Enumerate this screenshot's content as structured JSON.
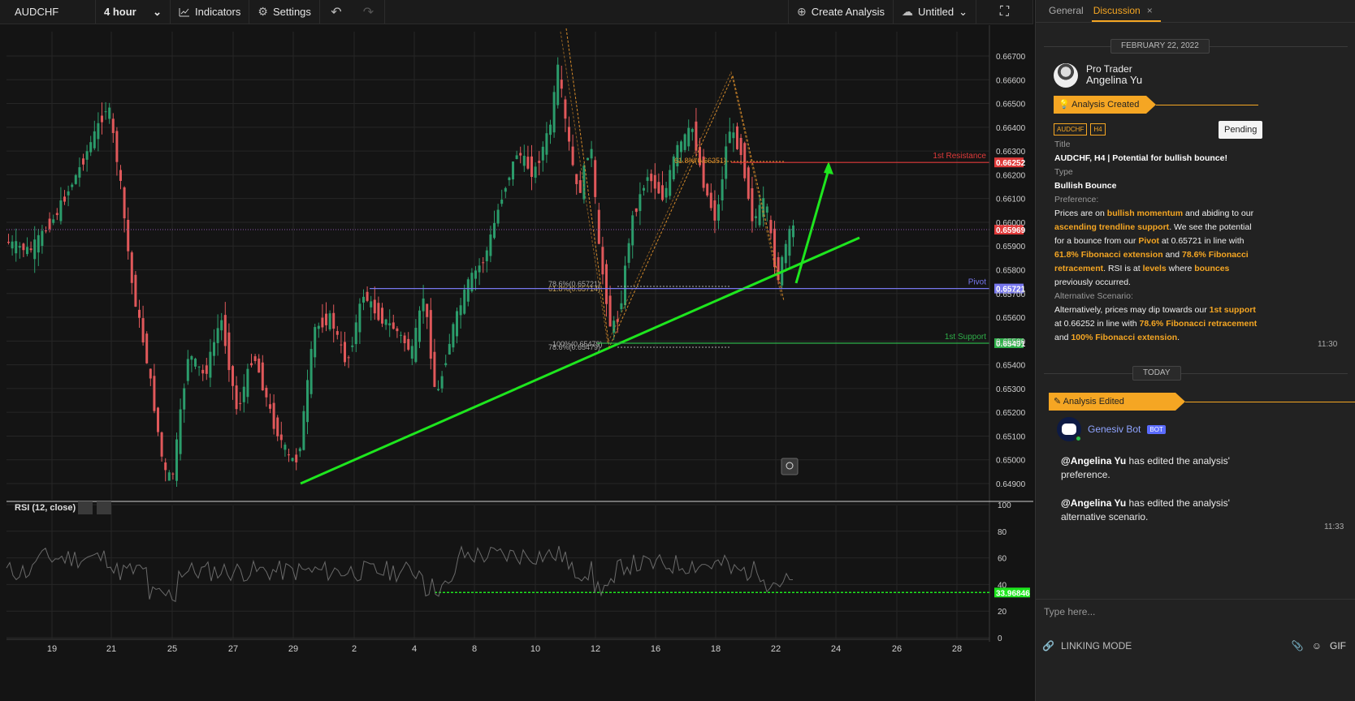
{
  "toolbar": {
    "symbol": "AUDCHF",
    "interval": "4 hour",
    "indicators_label": "Indicators",
    "settings_label": "Settings",
    "create_analysis_label": "Create Analysis",
    "layout_name": "Untitled"
  },
  "chart": {
    "price_ticks": [
      "0.66700",
      "0.66600",
      "0.66500",
      "0.66400",
      "0.66300",
      "0.66200",
      "0.66100",
      "0.66000",
      "0.65900",
      "0.65800",
      "0.65700",
      "0.65600",
      "0.65500",
      "0.65400",
      "0.65300",
      "0.65200",
      "0.65100",
      "0.65000",
      "0.64900"
    ],
    "date_ticks": [
      "19",
      "21",
      "25",
      "27",
      "29",
      "2",
      "4",
      "8",
      "10",
      "12",
      "16",
      "18",
      "20",
      "22",
      "24",
      "26",
      "28"
    ],
    "levels": [
      {
        "name": "1st Resistance",
        "price": 0.66252,
        "label": "0.66252",
        "color": "#e03a3a"
      },
      {
        "name": "Pivot",
        "price": 0.65721,
        "label": "0.65721",
        "color": "#7777ee"
      },
      {
        "name": "1st Support",
        "price": 0.65491,
        "label": "0.65491",
        "color": "#2fb04a"
      }
    ],
    "last_price": {
      "price": 0.65969,
      "label": "0.65969",
      "color": "#e03a3a"
    },
    "fib_labels": [
      "61.8%(0.66251)",
      "78.6%(0.65721)",
      "61.8%(0.65714)",
      "100%(0.65479)",
      "78.6%(0.65479)"
    ],
    "rsi": {
      "title": "RSI (12, close)",
      "ticks": [
        "100",
        "80",
        "60",
        "40",
        "20",
        "0"
      ],
      "value_label": "33.96846",
      "level": 33.96846
    }
  },
  "panel": {
    "tabs": [
      "General",
      "Discussion"
    ],
    "date1": "FEBRUARY 22, 2022",
    "author_role": "Pro Trader",
    "author_name": "Angelina Yu",
    "created_banner": "Analysis Created",
    "tags": [
      "AUDCHF",
      "H4"
    ],
    "status": "Pending",
    "title_label": "Title",
    "title_value": "AUDCHF, H4 | Potential for bullish bounce!",
    "type_label": "Type",
    "type_value": "Bullish Bounce",
    "pref_label": "Preference:",
    "pref": {
      "t1": "Prices are on ",
      "h1": "bullish momentum",
      "t2": " and abiding to our ",
      "h2": "ascending trendline support",
      "t3": ". We see the potential for a bounce from our ",
      "h3": "Pivot",
      "t4": " at 0.65721 in line with ",
      "h4": "61.8% Fibonacci extension",
      "t5": " and ",
      "h5": "78.6% Fibonacci retracement",
      "t6": ". RSI is at ",
      "h6": "levels",
      "t7": " where ",
      "h7": "bounces",
      "t8": " previously occurred."
    },
    "alt_label": "Alternative Scenario:",
    "alt": {
      "t1": "Alternatively, prices may dip towards our ",
      "h1": "1st support",
      "t2": " at 0.66252 in line with ",
      "h2": "78.6% Fibonacci retracement",
      "t3": " and ",
      "h3": "100% Fibonacci extension",
      "t4": "."
    },
    "time1": "11:30",
    "date2": "TODAY",
    "edited_banner": "Analysis Edited",
    "bot_name": "Genesiv Bot",
    "bot_badge": "BOT",
    "msg1_mention": "@Angelina Yu",
    "msg1_text": " has edited the analysis' preference.",
    "msg2_mention": "@Angelina Yu",
    "msg2_text": " has edited the analysis' alternative scenario.",
    "time2": "11:33",
    "input_placeholder": "Type here...",
    "linking_mode": "LINKING MODE",
    "gif_label": "GIF"
  }
}
